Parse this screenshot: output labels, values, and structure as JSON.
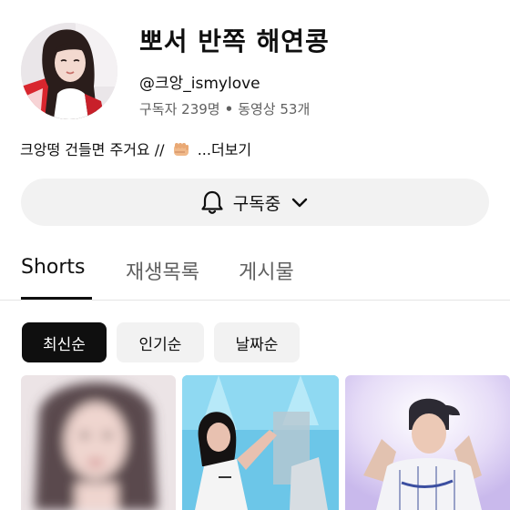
{
  "channel": {
    "name": "뽀서 반쪽 해연콩",
    "handle": "@크앙_ismylove",
    "subscribers": "구독자 239명",
    "separator": "•",
    "videos": "동영상 53개"
  },
  "description": {
    "text": "크앙떵 건들면 주거요 //",
    "emoji": "fist-emoji",
    "more": "...더보기"
  },
  "subscribe_button": {
    "label": "구독중",
    "icon": "bell-icon",
    "chevron": "chevron-down-icon"
  },
  "tabs": [
    {
      "label": "Shorts",
      "active": true
    },
    {
      "label": "재생목록",
      "active": false
    },
    {
      "label": "게시물",
      "active": false
    }
  ],
  "sort_chips": [
    {
      "label": "최신순",
      "active": true
    },
    {
      "label": "인기순",
      "active": false
    },
    {
      "label": "날짜순",
      "active": false
    }
  ],
  "colors": {
    "text_primary": "#0f0f0f",
    "text_secondary": "#606060",
    "chip_background": "#f2f2f2",
    "chip_active": "#0f0f0f",
    "divider": "#e5e5e5"
  }
}
